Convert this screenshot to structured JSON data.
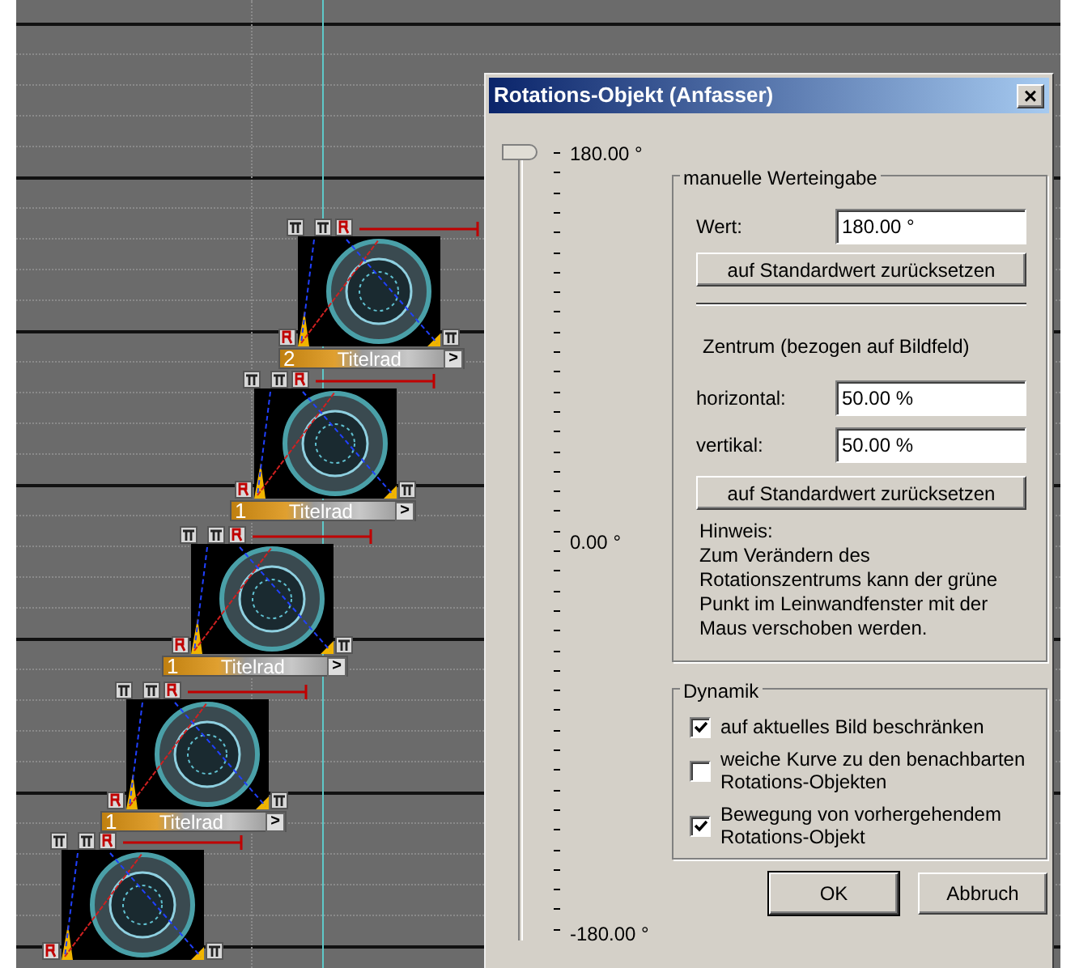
{
  "timeline": {
    "clips": [
      {
        "kind": "labeled",
        "bar": {
          "number": "2",
          "label": "Titelrad",
          "arrow": ">"
        }
      },
      {
        "kind": "labeled",
        "bar": {
          "number": "1",
          "label": "Titelrad",
          "arrow": ">"
        }
      },
      {
        "kind": "labeled",
        "bar": {
          "number": "1",
          "label": "Titelrad",
          "arrow": ">"
        }
      },
      {
        "kind": "labeled",
        "bar": {
          "number": "1",
          "label": "Titelrad",
          "arrow": ">"
        }
      },
      {
        "kind": "cut-off"
      }
    ]
  },
  "dialog": {
    "title": "Rotations-Objekt (Anfasser)",
    "close": "×",
    "slider": {
      "level": 1,
      "max_label": "180.00 °",
      "mid_label": "0.00 °",
      "min_label": "-180.00 °"
    },
    "manual": {
      "title": "manuelle Werteingabe",
      "value_label": "Wert:",
      "value": "180.00 °",
      "reset_button": "auf Standardwert zurücksetzen",
      "center_title": "Zentrum (bezogen auf Bildfeld)",
      "horizontal_label": "horizontal:",
      "horizontal": "50.00 %",
      "vertical_label": "vertikal:",
      "vertical": "50.00 %",
      "center_reset_button": "auf Standardwert zurücksetzen",
      "hint": [
        "Hinweis:",
        "Zum Verändern des",
        "Rotationszentrums kann der grüne",
        "Punkt  im Leinwandfenster mit der",
        "Maus verschoben werden."
      ]
    },
    "dynamics": {
      "title": "Dynamik",
      "options": [
        {
          "label": "auf aktuelles Bild beschränken",
          "checked": true
        },
        {
          "label": "weiche Kurve zu den benachbarten Rotations-Objekten",
          "checked": false
        },
        {
          "label": "Bewegung von vorhergehendem Rotations-Objekt",
          "checked": true
        }
      ]
    },
    "buttons": [
      {
        "label": "OK",
        "default": true
      },
      {
        "label": "Abbruch",
        "default": false
      }
    ]
  }
}
